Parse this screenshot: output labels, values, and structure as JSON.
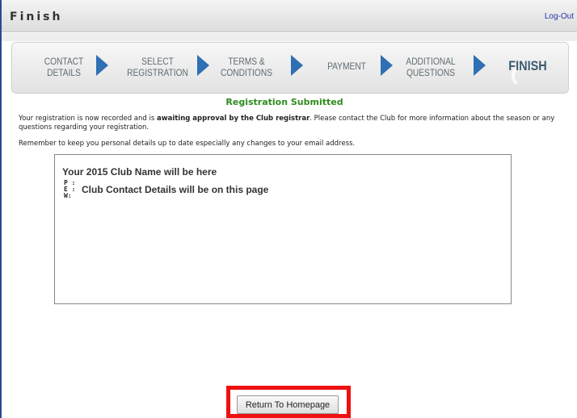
{
  "window": {
    "title": "Finish",
    "logout_label": "Log-Out"
  },
  "steps": [
    {
      "line1": "CONTACT",
      "line2": "DETAILS"
    },
    {
      "line1": "SELECT",
      "line2": "REGISTRATION"
    },
    {
      "line1": "TERMS &",
      "line2": "CONDITIONS"
    },
    {
      "line1": "PAYMENT",
      "line2": ""
    },
    {
      "line1": "ADDITIONAL",
      "line2": "QUESTIONS"
    },
    {
      "line1": "FINISH",
      "line2": ""
    }
  ],
  "colors": {
    "accent": "#2f6fb4",
    "heading": "#2e8b1e",
    "highlight": "#ee1111"
  },
  "content": {
    "heading": "Registration Submitted",
    "para1_before": "Your registration is now recorded and is ",
    "para1_bold": "awaiting approval by the Club registrar",
    "para1_after": ". Please contact the Club for more information about the season or any questions regarding your registration.",
    "para2": "Remember to keep you personal details up to date especially any changes to your email address."
  },
  "club_box": {
    "name": "Your 2015 Club Name will be here",
    "label_p": "P :",
    "label_e": "E :",
    "label_w": "W:",
    "contact_text": "Club Contact Details will be on this page"
  },
  "actions": {
    "return_home_label": "Return To Homepage"
  }
}
